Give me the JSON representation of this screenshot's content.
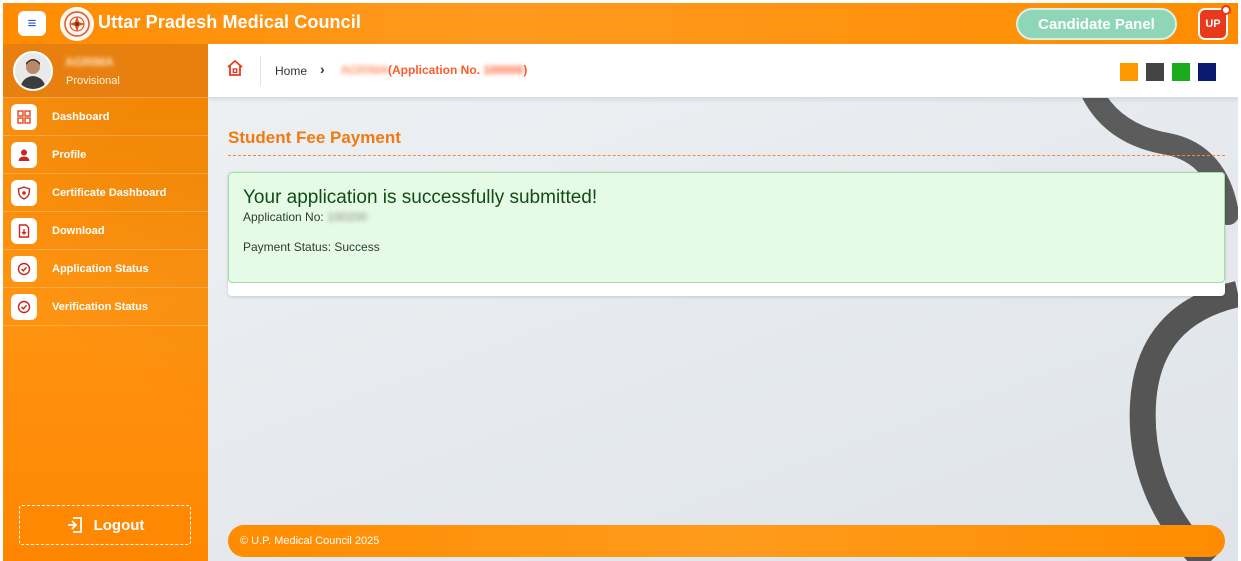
{
  "header": {
    "menu_icon": "hamburger-icon",
    "title": "Uttar Pradesh Medical Council",
    "candidate_panel_label": "Candidate Panel",
    "badge_label": "UP"
  },
  "sidebar": {
    "user": {
      "name": "AGRIMA",
      "role": "Provisional"
    },
    "items": [
      {
        "label": "Dashboard",
        "icon": "grid-icon"
      },
      {
        "label": "Profile",
        "icon": "user-icon"
      },
      {
        "label": "Certificate Dashboard",
        "icon": "shield-icon"
      },
      {
        "label": "Download",
        "icon": "download-icon"
      },
      {
        "label": "Application Status",
        "icon": "check-circle-icon"
      },
      {
        "label": "Verification Status",
        "icon": "check-circle-icon"
      }
    ],
    "logout_label": "Logout"
  },
  "breadcrumb": {
    "home": "Home",
    "name": "AGRIMA",
    "application_prefix": "(Application No. ",
    "application_number": "100000",
    "application_suffix": ")"
  },
  "theme_swatches": [
    "#ff9800",
    "#444444",
    "#1aaa1a",
    "#0a1a6e"
  ],
  "main": {
    "page_title": "Student Fee Payment",
    "success_title": "Your application is successfully submitted!",
    "application_no_label": "Application No:",
    "application_no_value": "100200",
    "payment_status": "Payment Status: Success"
  },
  "footer": {
    "text": "© U.P. Medical Council 2025"
  },
  "colors": {
    "brand_orange": "#ff8c00",
    "accent_title": "#f07a10",
    "success_bg": "#e6fbe6",
    "candidate_panel": "#8fd6b8"
  }
}
